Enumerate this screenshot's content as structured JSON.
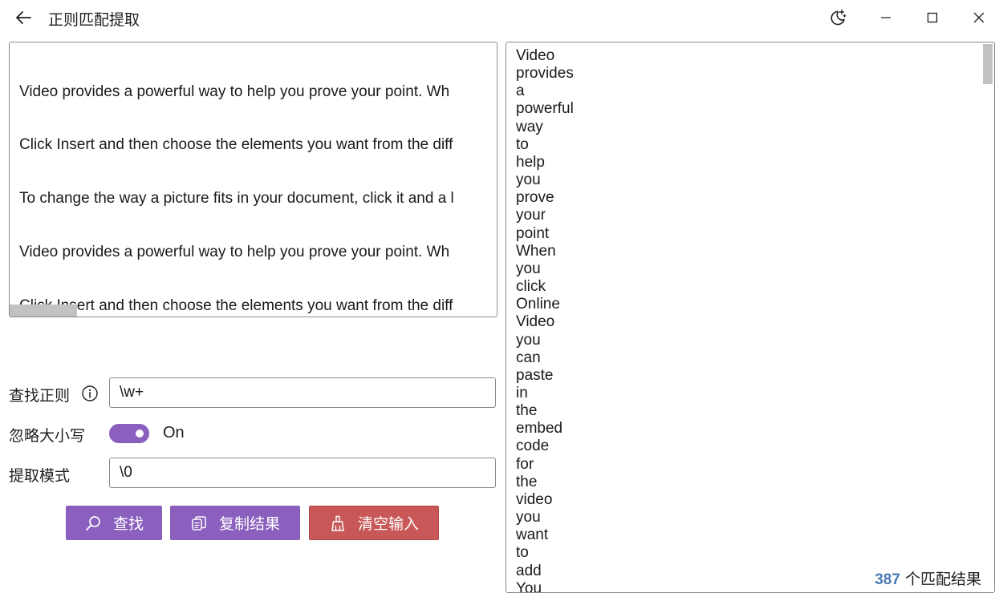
{
  "window": {
    "title": "正则匹配提取",
    "icons": {
      "back": "arrow-left-icon",
      "theme": "moon-sparkle-icon",
      "minimize": "minimize-icon",
      "maximize": "maximize-icon",
      "close": "close-icon"
    }
  },
  "input": {
    "lines": [
      "Video provides a powerful way to help you prove your point. Wh",
      "Click Insert and then choose the elements you want from the diff",
      "To change the way a picture fits in your document, click it and a l",
      "Video provides a powerful way to help you prove your point. Wh",
      "Click Insert and then choose the elements you want from the diff"
    ]
  },
  "form": {
    "regex_label": "查找正则",
    "regex_value": "\\w+",
    "ignore_case_label": "忽略大小写",
    "ignore_case_on": true,
    "ignore_case_state": "On",
    "pattern_label": "提取模式",
    "pattern_value": "\\0"
  },
  "buttons": {
    "search": "查找",
    "copy": "复制结果",
    "clear": "清空输入"
  },
  "accent_colors": {
    "purple": "#8a5fbd",
    "red": "#c85858",
    "count_blue": "#4a7bb5"
  },
  "results": {
    "items": [
      "Video",
      "provides",
      "a",
      "powerful",
      "way",
      "to",
      "help",
      "you",
      "prove",
      "your",
      "point",
      "When",
      "you",
      "click",
      "Online",
      "Video",
      "you",
      "can",
      "paste",
      "in",
      "the",
      "embed",
      "code",
      "for",
      "the",
      "video",
      "you",
      "want",
      "to",
      "add",
      "You"
    ],
    "count": "387",
    "count_suffix": "个匹配结果"
  }
}
